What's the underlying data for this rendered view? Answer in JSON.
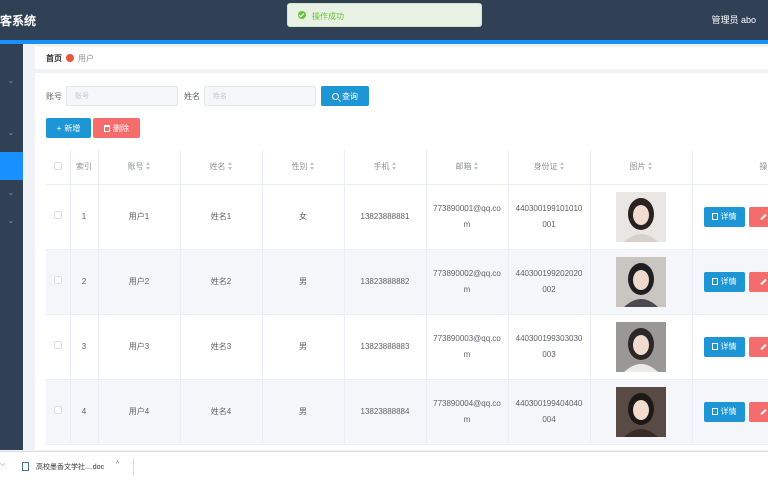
{
  "header": {
    "app_title": "客系统",
    "user_label": "管理员 abo"
  },
  "toast": {
    "message": "操作成功",
    "status_color": "#67c23a"
  },
  "breadcrumb": {
    "home": "首页",
    "current": "用户"
  },
  "search": {
    "account_label": "账号",
    "account_placeholder": "账号",
    "account_value": "",
    "name_label": "姓名",
    "name_placeholder": "姓名",
    "name_value": "",
    "query_label": "查询"
  },
  "actions": {
    "add_label": "新增",
    "delete_label": "删除"
  },
  "table": {
    "columns": [
      "索引",
      "账号",
      "姓名",
      "性别",
      "手机",
      "邮箱",
      "身份证",
      "图片",
      "操"
    ],
    "detail_label": "详情",
    "rows": [
      {
        "index": "1",
        "account": "用户1",
        "name": "姓名1",
        "gender": "女",
        "phone": "13823888881",
        "email_l1": "773890001@qq.co",
        "email_l2": "m",
        "idcard_l1": "440300199101010",
        "idcard_l2": "001",
        "photo_colors": [
          "#e9e6e3",
          "#2a2220",
          "#f2dcd0",
          "#d7d1cc"
        ]
      },
      {
        "index": "2",
        "account": "用户2",
        "name": "姓名2",
        "gender": "男",
        "phone": "13823888882",
        "email_l1": "773890002@qq.co",
        "email_l2": "m",
        "idcard_l1": "440300199202020",
        "idcard_l2": "002",
        "photo_colors": [
          "#c9c6c2",
          "#1f1f22",
          "#efd9cc",
          "#4a4a4f"
        ]
      },
      {
        "index": "3",
        "account": "用户3",
        "name": "姓名3",
        "gender": "男",
        "phone": "13823888883",
        "email_l1": "773890003@qq.co",
        "email_l2": "m",
        "idcard_l1": "440300199303030",
        "idcard_l2": "003",
        "photo_colors": [
          "#9a9896",
          "#2b2727",
          "#f0dccf",
          "#ecebe7"
        ]
      },
      {
        "index": "4",
        "account": "用户4",
        "name": "姓名4",
        "gender": "男",
        "phone": "13823888884",
        "email_l1": "773890004@qq.co",
        "email_l2": "m",
        "idcard_l1": "440300199404040",
        "idcard_l2": "004",
        "photo_colors": [
          "#5a4a44",
          "#1e1816",
          "#f1dccd",
          "#3a2c28"
        ]
      }
    ]
  },
  "download": {
    "filename": "高校墨香文学社....doc"
  },
  "colors": {
    "topbar": "#304156",
    "accent": "#1890ff",
    "primary_button": "#1e95d4",
    "danger_button": "#f56c6c"
  }
}
